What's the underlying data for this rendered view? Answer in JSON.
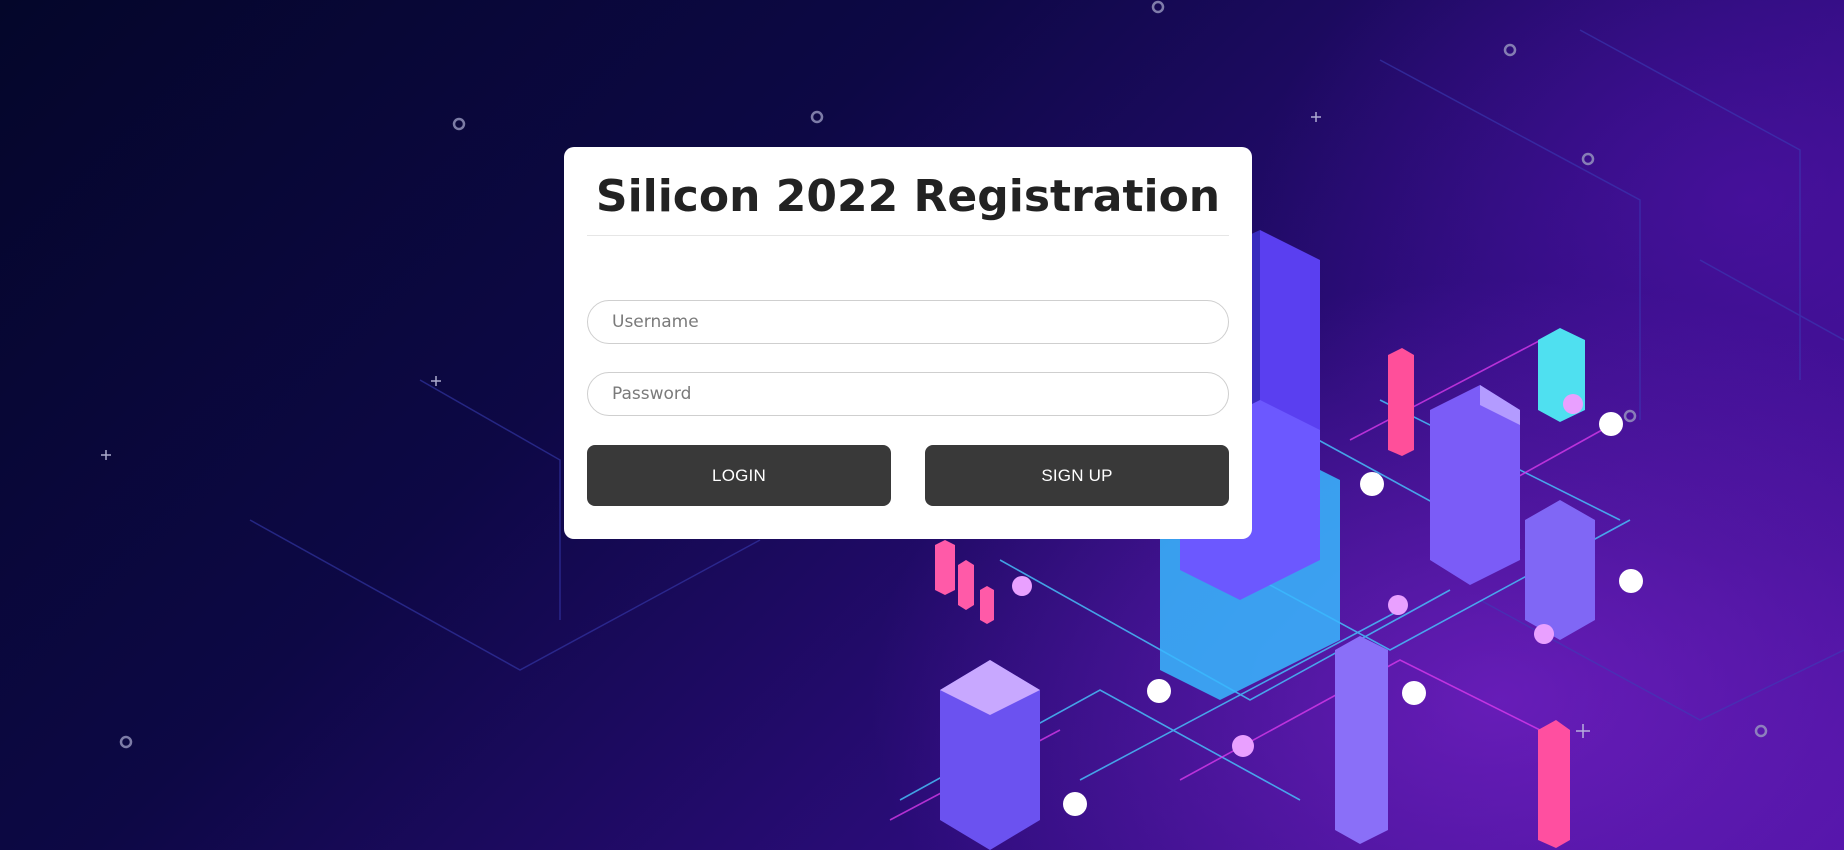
{
  "page": {
    "title": "Silicon 2022 Registration"
  },
  "form": {
    "username_placeholder": "Username",
    "username_value": "",
    "password_placeholder": "Password",
    "password_value": "",
    "login_label": "LOGIN",
    "signup_label": "SIGN UP"
  },
  "colors": {
    "background_dark": "#04062a",
    "background_accent": "#4a12a0",
    "card": "#ffffff",
    "button": "#393939",
    "button_text": "#ffffff"
  },
  "icons": [
    "shield-icon",
    "thermometer-icon",
    "home-icon",
    "location-pin-icon",
    "chart-icon",
    "facebook-icon"
  ]
}
